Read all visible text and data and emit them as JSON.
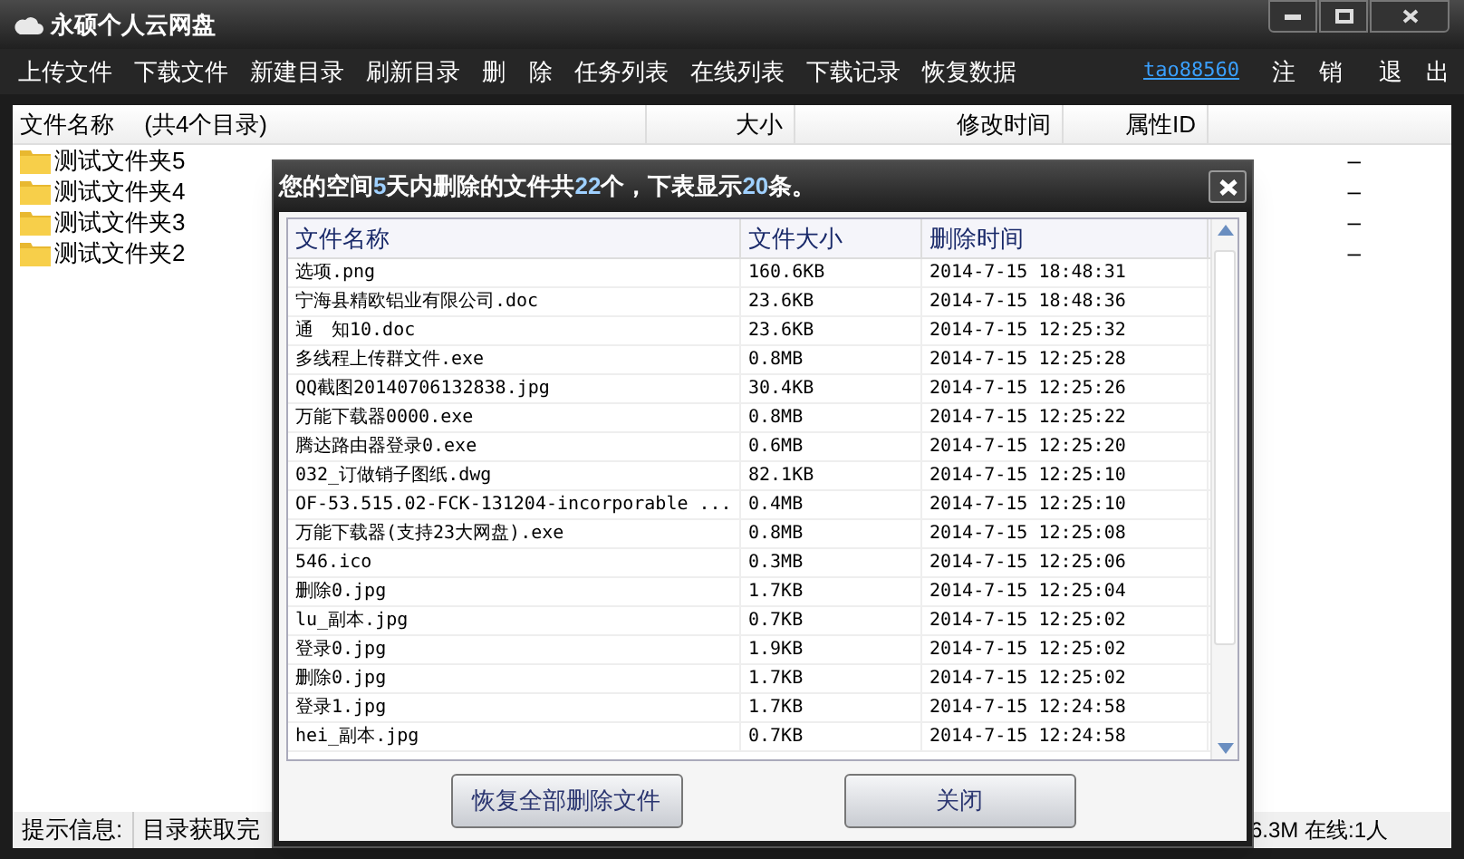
{
  "window": {
    "title": "永硕个人云网盘"
  },
  "toolbar": {
    "items": [
      "上传文件",
      "下载文件",
      "新建目录",
      "刷新目录",
      "删　除",
      "任务列表",
      "在线列表",
      "下载记录",
      "恢复数据"
    ],
    "user": "tao88560",
    "logout": "注　销",
    "exit": "退　出"
  },
  "file_list": {
    "columns": [
      "文件名称　 (共4个目录)",
      "大小",
      "修改时间",
      "属性ID"
    ],
    "rows": [
      {
        "name": "测试文件夹5",
        "column_5": "–"
      },
      {
        "name": "测试文件夹4",
        "column_5": "–"
      },
      {
        "name": "测试文件夹3",
        "column_5": "–"
      },
      {
        "name": "测试文件夹2",
        "column_5": "–"
      }
    ]
  },
  "status_bar": {
    "label": "提示信息:",
    "message": "目录获取完",
    "right": "6.3M 在线:1人"
  },
  "dialog": {
    "title": "您的空间**5**天内删除的文件共**22**个，下表显示**20**条。",
    "columns": [
      "文件名称",
      "文件大小",
      "删除时间"
    ],
    "rows": [
      {
        "name": "选项.png",
        "size": "160.6KB",
        "time": "2014-7-15 18:48:31"
      },
      {
        "name": "宁海县精欧铝业有限公司.doc",
        "size": "23.6KB",
        "time": "2014-7-15 18:48:36"
      },
      {
        "name": "通　知10.doc",
        "size": "23.6KB",
        "time": "2014-7-15 12:25:32"
      },
      {
        "name": "多线程上传群文件.exe",
        "size": "0.8MB",
        "time": "2014-7-15 12:25:28"
      },
      {
        "name": "QQ截图20140706132838.jpg",
        "size": "30.4KB",
        "time": "2014-7-15 12:25:26"
      },
      {
        "name": "万能下载器0000.exe",
        "size": "0.8MB",
        "time": "2014-7-15 12:25:22"
      },
      {
        "name": "腾达路由器登录0.exe",
        "size": "0.6MB",
        "time": "2014-7-15 12:25:20"
      },
      {
        "name": "032_订做销子图纸.dwg",
        "size": "82.1KB",
        "time": "2014-7-15 12:25:10"
      },
      {
        "name": "OF-53.515.02-FCK-131204-incorporable ...",
        "size": "0.4MB",
        "time": "2014-7-15 12:25:10"
      },
      {
        "name": "万能下载器(支持23大网盘).exe",
        "size": "0.8MB",
        "time": "2014-7-15 12:25:08"
      },
      {
        "name": "546.ico",
        "size": "0.3MB",
        "time": "2014-7-15 12:25:06"
      },
      {
        "name": "删除0.jpg",
        "size": "1.7KB",
        "time": "2014-7-15 12:25:04"
      },
      {
        "name": "lu_副本.jpg",
        "size": "0.7KB",
        "time": "2014-7-15 12:25:02"
      },
      {
        "name": "登录0.jpg",
        "size": "1.9KB",
        "time": "2014-7-15 12:25:02"
      },
      {
        "name": "删除0.jpg",
        "size": "1.7KB",
        "time": "2014-7-15 12:25:02"
      },
      {
        "name": "登录1.jpg",
        "size": "1.7KB",
        "time": "2014-7-15 12:24:58"
      },
      {
        "name": "hei_副本.jpg",
        "size": "0.7KB",
        "time": "2014-7-15 12:24:58"
      }
    ],
    "buttons": [
      "恢复全部删除文件",
      "关闭"
    ]
  }
}
